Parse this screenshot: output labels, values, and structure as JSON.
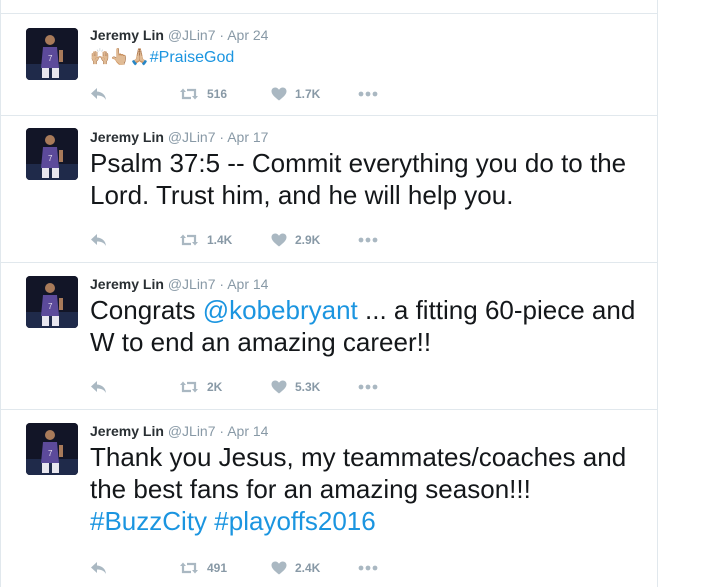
{
  "tweets": [
    {
      "author": "Jeremy Lin",
      "handle": "@JLin7",
      "date": "Apr 24",
      "emoji": "🙌🏼👆🏼🙏🏼",
      "hashtag": "#PraiseGod",
      "retweets": "516",
      "likes": "1.7K"
    },
    {
      "author": "Jeremy Lin",
      "handle": "@JLin7",
      "date": "Apr 17",
      "text": "Psalm 37:5 -- Commit everything you do to the Lord. Trust him, and he will help you.",
      "retweets": "1.4K",
      "likes": "2.9K"
    },
    {
      "author": "Jeremy Lin",
      "handle": "@JLin7",
      "date": "Apr 14",
      "text_before": "Congrats ",
      "mention": "@kobebryant",
      "text_after": " ... a fitting 60-piece and W to end an amazing career!!",
      "retweets": "2K",
      "likes": "5.3K"
    },
    {
      "author": "Jeremy Lin",
      "handle": "@JLin7",
      "date": "Apr 14",
      "text": "Thank you Jesus, my teammates/coaches and the best fans for an amazing season!!!",
      "hashtag1": "#BuzzCity",
      "hashtag2": "#playoffs2016",
      "retweets": "491",
      "likes": "2.4K"
    }
  ],
  "separator": "·",
  "icons": {
    "reply": "reply-icon",
    "retweet": "retweet-icon",
    "like": "heart-icon",
    "more": "more-icon"
  },
  "colors": {
    "link": "#1b95e0",
    "meta": "#8899a6",
    "icon": "#aab8c2",
    "jersey": "#5c4a9a"
  }
}
